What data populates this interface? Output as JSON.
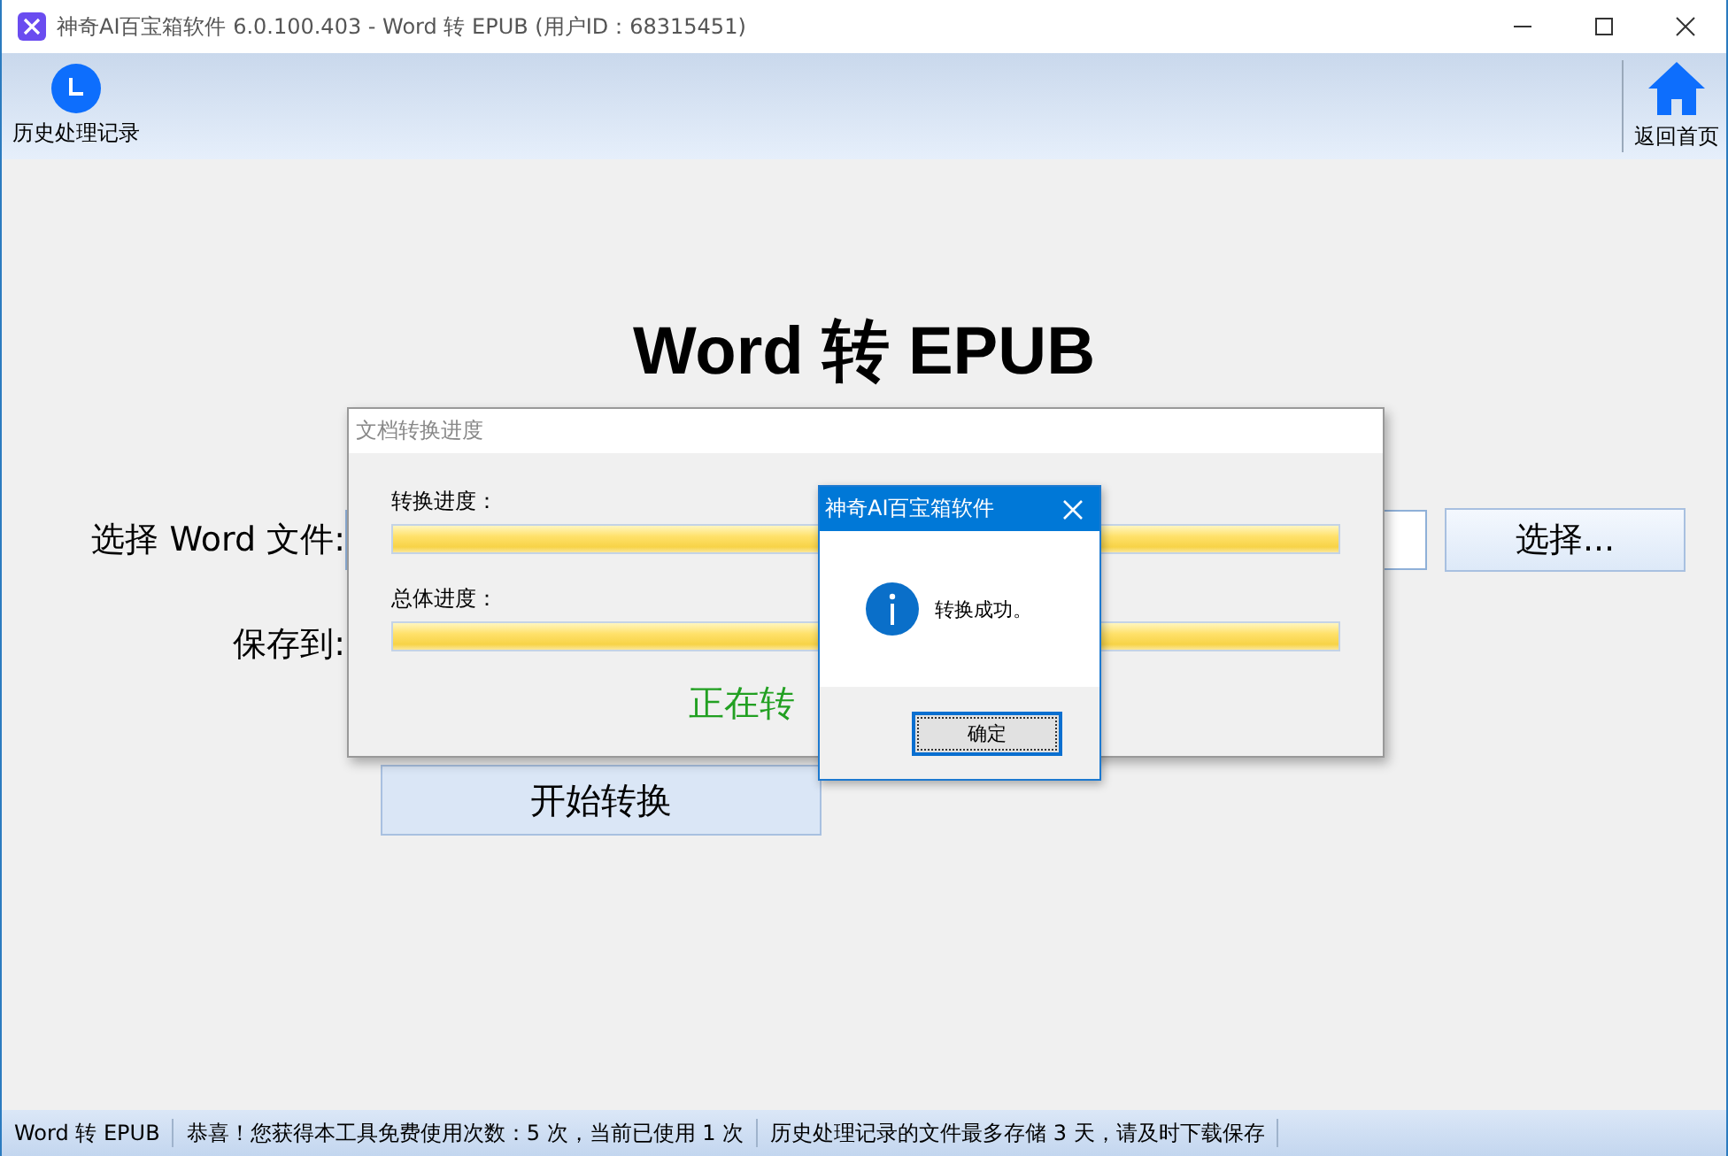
{
  "window": {
    "title": "神奇AI百宝箱软件 6.0.100.403 - Word 转 EPUB (用户ID：68315451)"
  },
  "toolbar": {
    "left": {
      "label": "历史处理记录"
    },
    "right": {
      "label": "返回首页"
    }
  },
  "main": {
    "heading": "Word 转 EPUB",
    "file_label": "选择 Word 文件:",
    "choose_button": "选择...",
    "save_label": "保存到:",
    "start_button": "开始转换"
  },
  "progress_dialog": {
    "title": "文档转换进度",
    "bars": [
      {
        "label": "转换进度：",
        "level": 1
      },
      {
        "label": "总体进度：",
        "level": 1
      }
    ],
    "status": "正在转"
  },
  "message_box": {
    "title": "神奇AI百宝箱软件",
    "message": "转换成功。",
    "ok_button": "确定"
  },
  "status_bar": [
    "Word 转 EPUB",
    "恭喜！您获得本工具免费使用次数：5 次，当前已使用 1 次",
    "历史处理记录的文件最多存储 3 天，请及时下载保存"
  ]
}
